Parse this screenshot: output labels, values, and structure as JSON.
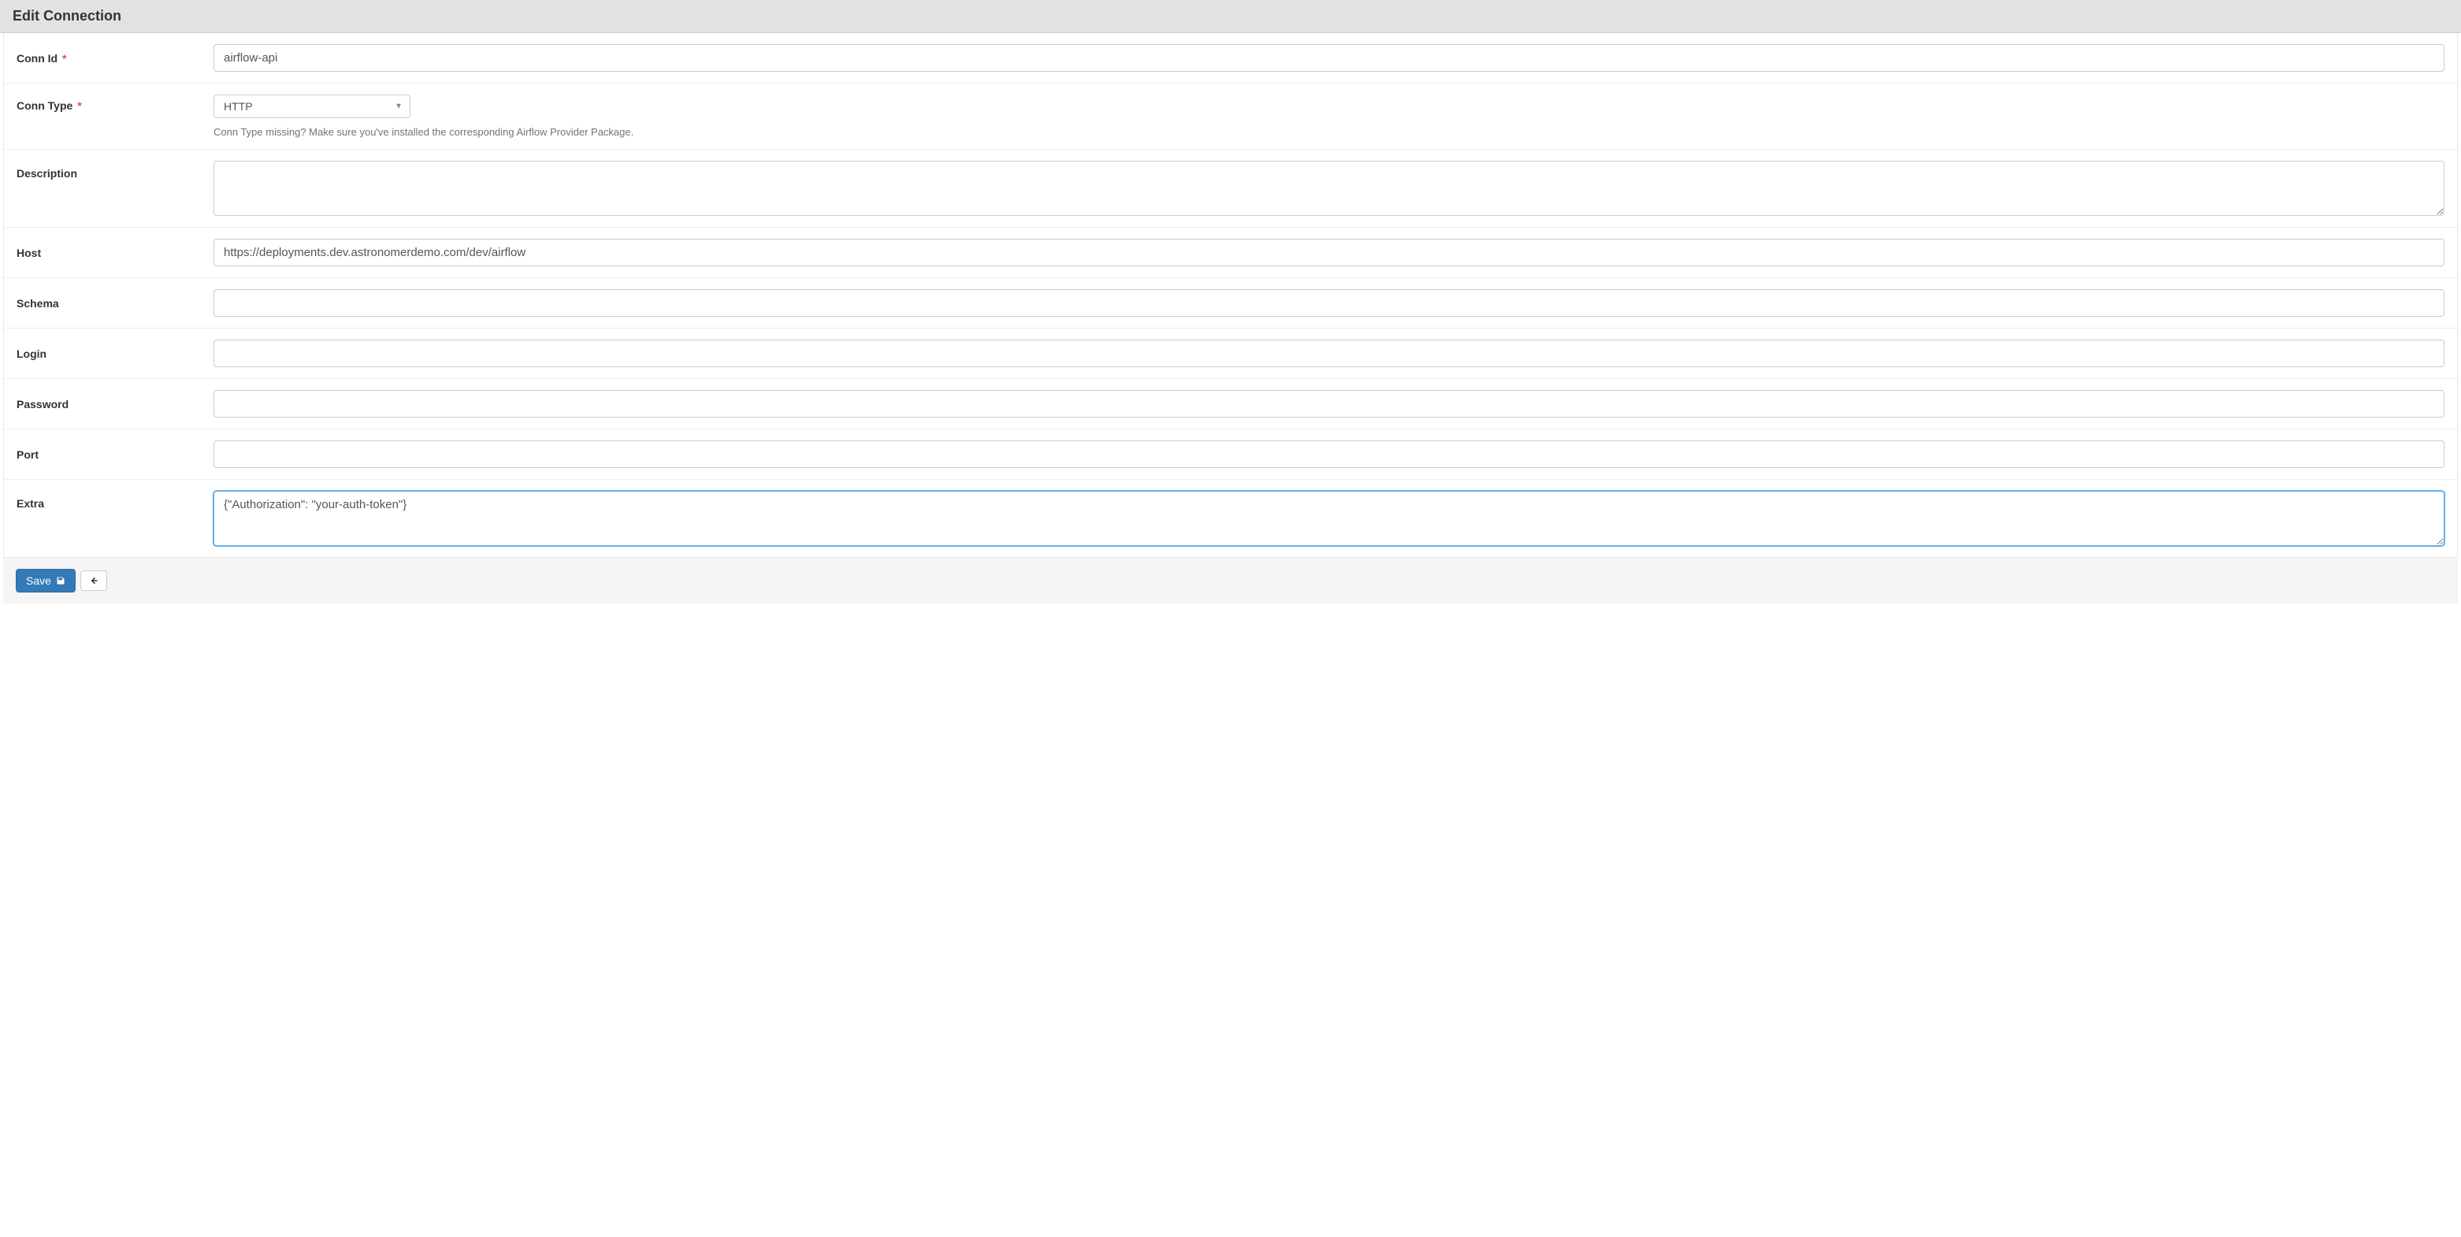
{
  "header": {
    "title": "Edit Connection"
  },
  "form": {
    "conn_id": {
      "label": "Conn Id",
      "required_mark": "*",
      "value": "airflow-api"
    },
    "conn_type": {
      "label": "Conn Type",
      "required_mark": "*",
      "selected": "HTTP",
      "help": "Conn Type missing? Make sure you've installed the corresponding Airflow Provider Package."
    },
    "description": {
      "label": "Description",
      "value": ""
    },
    "host": {
      "label": "Host",
      "value": "https://deployments.dev.astronomerdemo.com/dev/airflow"
    },
    "schema": {
      "label": "Schema",
      "value": ""
    },
    "login": {
      "label": "Login",
      "value": ""
    },
    "password": {
      "label": "Password",
      "value": ""
    },
    "port": {
      "label": "Port",
      "value": ""
    },
    "extra": {
      "label": "Extra",
      "value": "{\"Authorization\": \"your-auth-token\"}"
    }
  },
  "footer": {
    "save_label": "Save"
  }
}
